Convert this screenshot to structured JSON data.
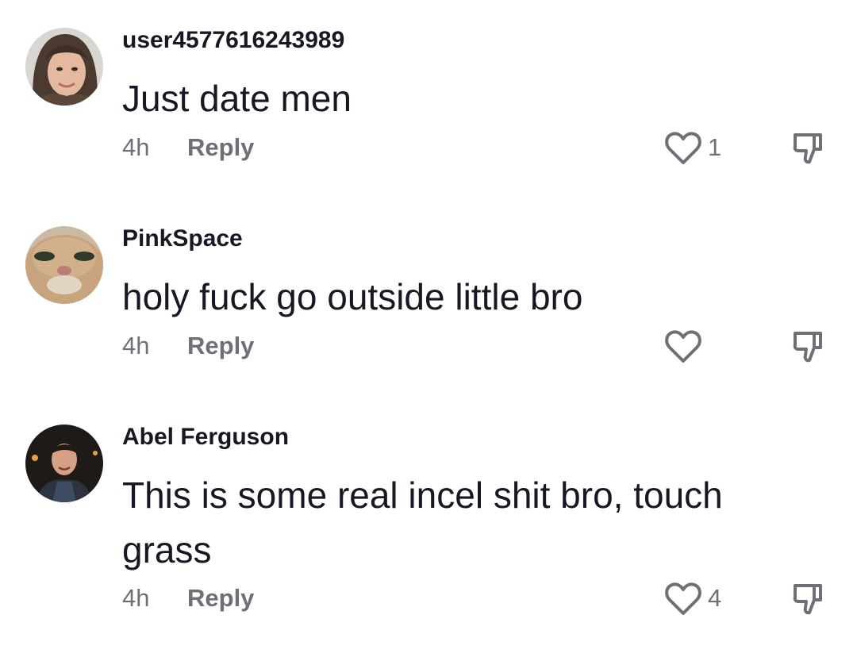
{
  "comments": [
    {
      "username": "user4577616243989",
      "text": "Just date men",
      "time": "4h",
      "reply_label": "Reply",
      "like_count": "1",
      "avatar_icon": "avatar-photo-woman",
      "like_icon": "heart-outline-icon",
      "dislike_icon": "thumbs-down-icon"
    },
    {
      "username": "PinkSpace",
      "text": "holy fuck go outside little bro",
      "time": "4h",
      "reply_label": "Reply",
      "like_count": "",
      "avatar_icon": "avatar-photo-cat",
      "like_icon": "heart-outline-icon",
      "dislike_icon": "thumbs-down-icon"
    },
    {
      "username": "Abel Ferguson",
      "text": "This is some real incel shit bro, touch grass",
      "time": "4h",
      "reply_label": "Reply",
      "like_count": "4",
      "avatar_icon": "avatar-photo-man",
      "like_icon": "heart-outline-icon",
      "dislike_icon": "thumbs-down-icon"
    }
  ],
  "colors": {
    "primary_text": "#161823",
    "secondary_text": "#6f7077",
    "icon": "#6f7077",
    "background": "#ffffff"
  }
}
